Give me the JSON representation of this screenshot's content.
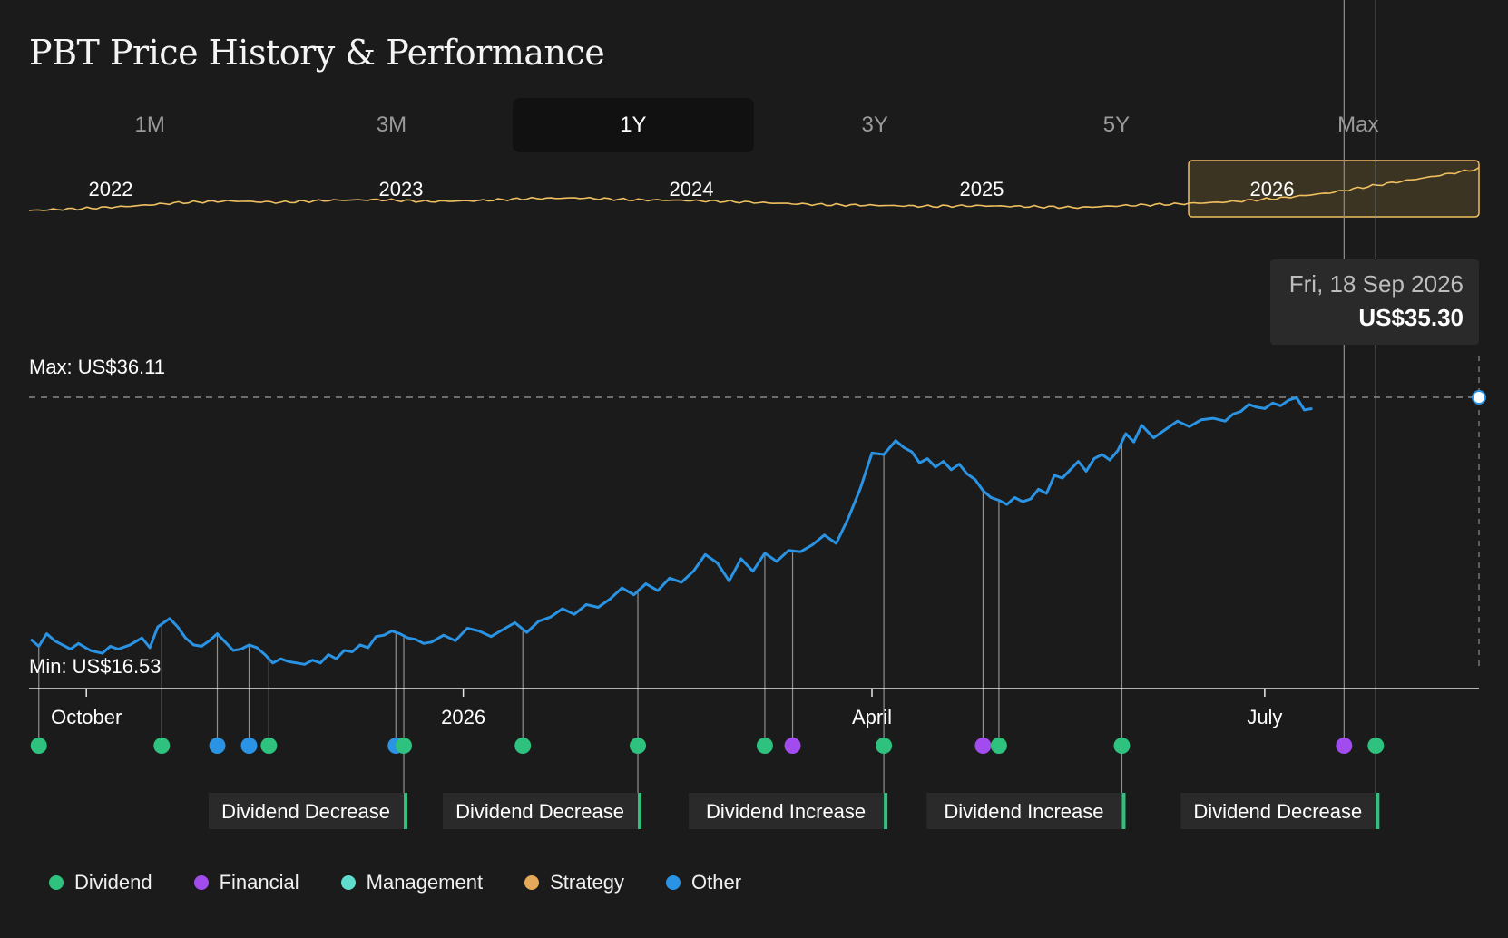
{
  "title": "PBT Price History & Performance",
  "tabs": [
    {
      "label": "1M",
      "active": false
    },
    {
      "label": "3M",
      "active": false
    },
    {
      "label": "1Y",
      "active": true
    },
    {
      "label": "3Y",
      "active": false
    },
    {
      "label": "5Y",
      "active": false
    },
    {
      "label": "Max",
      "active": false
    }
  ],
  "tooltip": {
    "date": "Fri, 18 Sep 2026",
    "price": "US$35.30"
  },
  "colors": {
    "price_line": "#2a93e3",
    "navigator_line": "#f0c060",
    "dividend": "#2ec27e",
    "financial": "#a24cf0",
    "management": "#5fdccb",
    "strategy": "#e5a95a",
    "other": "#2a93e3"
  },
  "legend": [
    {
      "label": "Dividend",
      "color": "#2ec27e"
    },
    {
      "label": "Financial",
      "color": "#a24cf0"
    },
    {
      "label": "Management",
      "color": "#5fdccb"
    },
    {
      "label": "Strategy",
      "color": "#e5a95a"
    },
    {
      "label": "Other",
      "color": "#2a93e3"
    }
  ],
  "chart_data": [
    {
      "type": "line",
      "name": "navigator",
      "x_labels": [
        "2022",
        "2023",
        "2024",
        "2025",
        "2026"
      ],
      "selected_range": "1Y",
      "series": [
        {
          "values": [
            16.2,
            16.8,
            17.6,
            18.8,
            19.4,
            18.9,
            19.6,
            19.8,
            19.2,
            19.5,
            20.2,
            20.4,
            19.8,
            19.6,
            19.2,
            18.6,
            18.1,
            17.9,
            17.6,
            17.8,
            17.5,
            17.2,
            17.9,
            18.4,
            19.1,
            20.3,
            22.1,
            24.8,
            27.4,
            30.2
          ]
        }
      ]
    },
    {
      "type": "line",
      "name": "price",
      "unit": "US$",
      "x_ticks": [
        "October",
        "2026",
        "April",
        "July"
      ],
      "y_max_label": "Max: US$36.11",
      "y_min_label": "Min: US$16.53",
      "ylim": [
        16.53,
        36.11
      ],
      "x": [
        0,
        2,
        4,
        6,
        8,
        10,
        12,
        15,
        18,
        20,
        22,
        25,
        28,
        30,
        32,
        35,
        37,
        39,
        41,
        43,
        45,
        47,
        49,
        51,
        53,
        55,
        57,
        59,
        61,
        63,
        65,
        67,
        69,
        71,
        73,
        75,
        77,
        79,
        81,
        83,
        85,
        87,
        89,
        91,
        93,
        95,
        97,
        99,
        101,
        104,
        107,
        110,
        113,
        116,
        119,
        122,
        125,
        128,
        131,
        134,
        137,
        140,
        143,
        146,
        149,
        152,
        155,
        158,
        161,
        164,
        167,
        170,
        173,
        176,
        179,
        182,
        185,
        188,
        191,
        194,
        197,
        200,
        203,
        206,
        209,
        212,
        215,
        218,
        220,
        222,
        224,
        226,
        228,
        230,
        232,
        234,
        236,
        238,
        240,
        242,
        244,
        246,
        248,
        250,
        252,
        254,
        256,
        258,
        260,
        262,
        264,
        266,
        268,
        270,
        272,
        274,
        276,
        278,
        280,
        283,
        286,
        289,
        292,
        295,
        298,
        301,
        303,
        305,
        307,
        309,
        311,
        313,
        315,
        317,
        319,
        321,
        323,
        325,
        327,
        329,
        331,
        333,
        335,
        337,
        339,
        341,
        343,
        345,
        347,
        349,
        351,
        353,
        355,
        357,
        359,
        361,
        363,
        365
      ],
      "series": [
        {
          "values": [
            18.7,
            18.2,
            19.1,
            18.6,
            18.3,
            18.0,
            18.4,
            17.9,
            17.7,
            18.2,
            18.0,
            18.3,
            18.8,
            18.1,
            19.6,
            20.2,
            19.6,
            18.8,
            18.3,
            18.2,
            18.6,
            19.1,
            18.5,
            17.9,
            18.0,
            18.3,
            18.1,
            17.6,
            17.0,
            17.3,
            17.1,
            17.0,
            16.9,
            17.2,
            17.0,
            17.6,
            17.3,
            17.9,
            17.8,
            18.3,
            18.1,
            18.9,
            19.0,
            19.3,
            19.1,
            18.8,
            18.7,
            18.4,
            18.5,
            19.0,
            18.6,
            19.5,
            19.3,
            18.9,
            19.4,
            19.9,
            19.2,
            20.0,
            20.3,
            20.9,
            20.5,
            21.2,
            21.0,
            21.6,
            22.4,
            21.9,
            22.7,
            22.2,
            23.1,
            22.8,
            23.6,
            24.8,
            24.2,
            22.9,
            24.5,
            23.6,
            24.9,
            24.3,
            25.1,
            25.0,
            25.5,
            26.2,
            25.6,
            27.4,
            29.5,
            32.1,
            32.0,
            33.0,
            32.5,
            32.2,
            31.4,
            31.7,
            31.1,
            31.5,
            30.9,
            31.3,
            30.6,
            30.2,
            29.4,
            28.9,
            28.7,
            28.4,
            28.9,
            28.6,
            28.8,
            29.5,
            29.2,
            30.5,
            30.3,
            30.9,
            31.5,
            30.8,
            31.7,
            32.0,
            31.6,
            32.3,
            33.5,
            32.9,
            34.1,
            33.2,
            33.8,
            34.4,
            34.0,
            34.5,
            34.6,
            34.4,
            34.9,
            35.1,
            35.6,
            35.4,
            35.3,
            35.7,
            35.5,
            35.9,
            36.1,
            35.2,
            35.3
          ]
        }
      ]
    }
  ],
  "events": [
    {
      "x": 2,
      "category": "dividend",
      "label": ""
    },
    {
      "x": 33,
      "category": "dividend",
      "label": ""
    },
    {
      "x": 47,
      "category": "other",
      "label": ""
    },
    {
      "x": 55,
      "category": "other",
      "label": ""
    },
    {
      "x": 60,
      "category": "dividend",
      "label": ""
    },
    {
      "x": 92,
      "category": "other",
      "label": ""
    },
    {
      "x": 94,
      "category": "dividend",
      "label": "Dividend Decrease"
    },
    {
      "x": 124,
      "category": "dividend",
      "label": ""
    },
    {
      "x": 153,
      "category": "dividend",
      "label": "Dividend Decrease"
    },
    {
      "x": 185,
      "category": "dividend",
      "label": ""
    },
    {
      "x": 192,
      "category": "financial",
      "label": ""
    },
    {
      "x": 215,
      "category": "dividend",
      "label": "Dividend Increase"
    },
    {
      "x": 240,
      "category": "financial",
      "label": ""
    },
    {
      "x": 244,
      "category": "dividend",
      "label": ""
    },
    {
      "x": 275,
      "category": "dividend",
      "label": "Dividend Increase"
    },
    {
      "x": 331,
      "category": "financial",
      "label": ""
    },
    {
      "x": 339,
      "category": "dividend",
      "label": "Dividend Decrease"
    }
  ]
}
